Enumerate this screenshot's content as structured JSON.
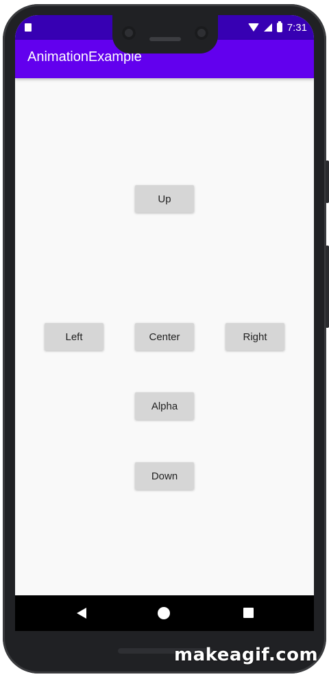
{
  "statusbar": {
    "time": "7:31",
    "icons": [
      "sim-card-icon",
      "wifi-icon",
      "signal-icon",
      "battery-charging-icon"
    ]
  },
  "appbar": {
    "title": "AnimationExample"
  },
  "buttons": {
    "up": "Up",
    "left": "Left",
    "center": "Center",
    "right": "Right",
    "alpha": "Alpha",
    "down": "Down"
  },
  "navbar": {
    "icons": [
      "back-icon",
      "home-icon",
      "recents-icon"
    ]
  },
  "watermark": "makeagif.com",
  "colors": {
    "primary": "#6200ee",
    "primary_dark": "#3700b3",
    "button": "#d6d6d6",
    "background": "#f9f9f9"
  }
}
